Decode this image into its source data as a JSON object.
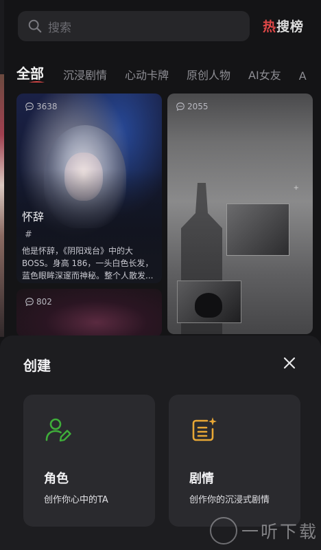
{
  "search": {
    "placeholder": "搜索"
  },
  "header": {
    "hot_list_first": "热",
    "hot_list_rest": "搜榜"
  },
  "tabs": [
    {
      "label": "全部",
      "active": true
    },
    {
      "label": "沉浸剧情"
    },
    {
      "label": "心动卡牌"
    },
    {
      "label": "原创人物"
    },
    {
      "label": "AI女友"
    },
    {
      "label": "A"
    }
  ],
  "cards": [
    {
      "views": "3638",
      "name": "怀辞",
      "hash": "#",
      "description": "他是怀辞，《阴阳戏台》中的大BOSS。身高 186，一头白色长发，蓝色眼眸深邃而神秘。整个人散发..."
    },
    {
      "views": "2055",
      "mark": "+"
    },
    {
      "views": "802"
    }
  ],
  "sheet": {
    "title": "创建",
    "options": [
      {
        "title": "角色",
        "subtitle": "创作你心中的TA",
        "icon": "user-edit-icon",
        "color": "#3fae3a"
      },
      {
        "title": "剧情",
        "subtitle": "创作你的沉浸式剧情",
        "icon": "script-spark-icon",
        "color": "#e8a735"
      }
    ]
  },
  "watermark": {
    "text": "一听下载"
  },
  "colors": {
    "accent_red": "#e04848",
    "background": "#141416",
    "sheet": "#1d1d20",
    "card": "#2a2a2e"
  }
}
